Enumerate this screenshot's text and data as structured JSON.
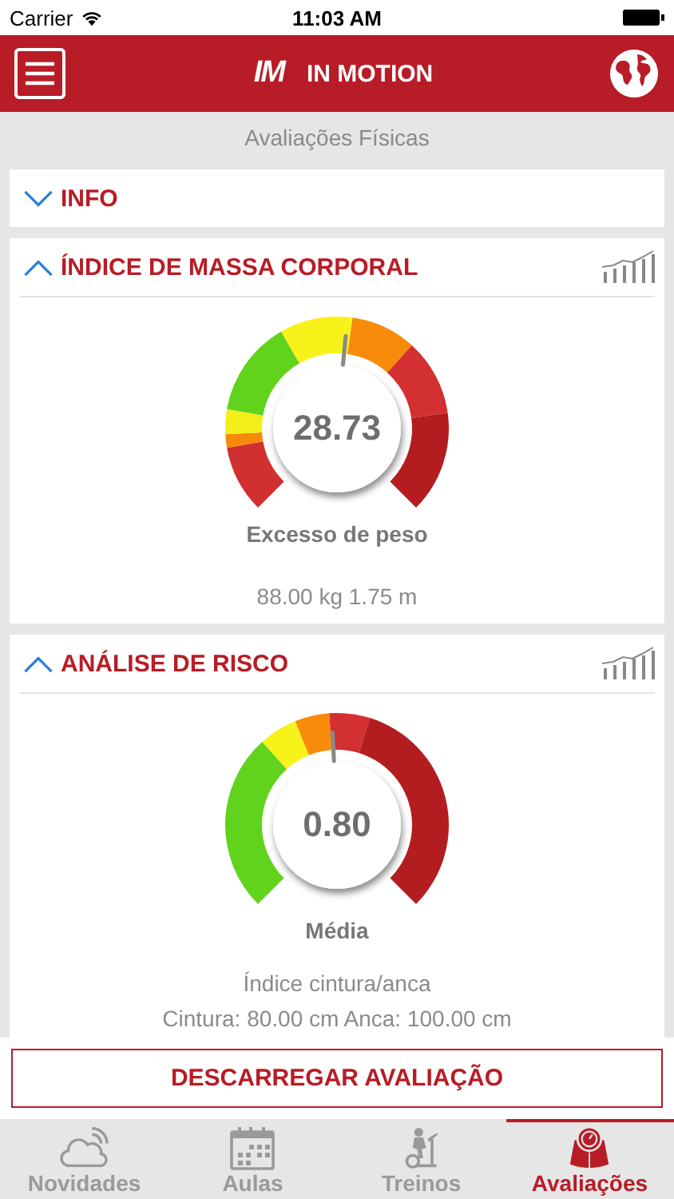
{
  "status_bar": {
    "carrier": "Carrier",
    "time": "11:03 AM"
  },
  "header": {
    "logo": "IM",
    "title": "IN MOTION"
  },
  "subtitle": "Avaliações Físicas",
  "sections": [
    {
      "title": "INFO",
      "expanded": false
    },
    {
      "title": "ÍNDICE DE MASSA CORPORAL",
      "expanded": true,
      "gauge": {
        "kind": "bmi",
        "value": "28.73",
        "label": "Excesso de peso"
      },
      "details": [
        "88.00 kg  1.75 m"
      ]
    },
    {
      "title": "ANÁLISE DE RISCO",
      "expanded": true,
      "gauge": {
        "kind": "whr",
        "value": "0.80",
        "label": "Média"
      },
      "details": [
        "Índice cintura/anca",
        "Cintura: 80.00 cm  Anca: 100.00 cm"
      ]
    }
  ],
  "download_button": "DESCARREGAR AVALIAÇÃO",
  "tabs": [
    {
      "label": "Novidades",
      "selected": false
    },
    {
      "label": "Aulas",
      "selected": false
    },
    {
      "label": "Treinos",
      "selected": false
    },
    {
      "label": "Avaliações",
      "selected": true
    }
  ]
}
